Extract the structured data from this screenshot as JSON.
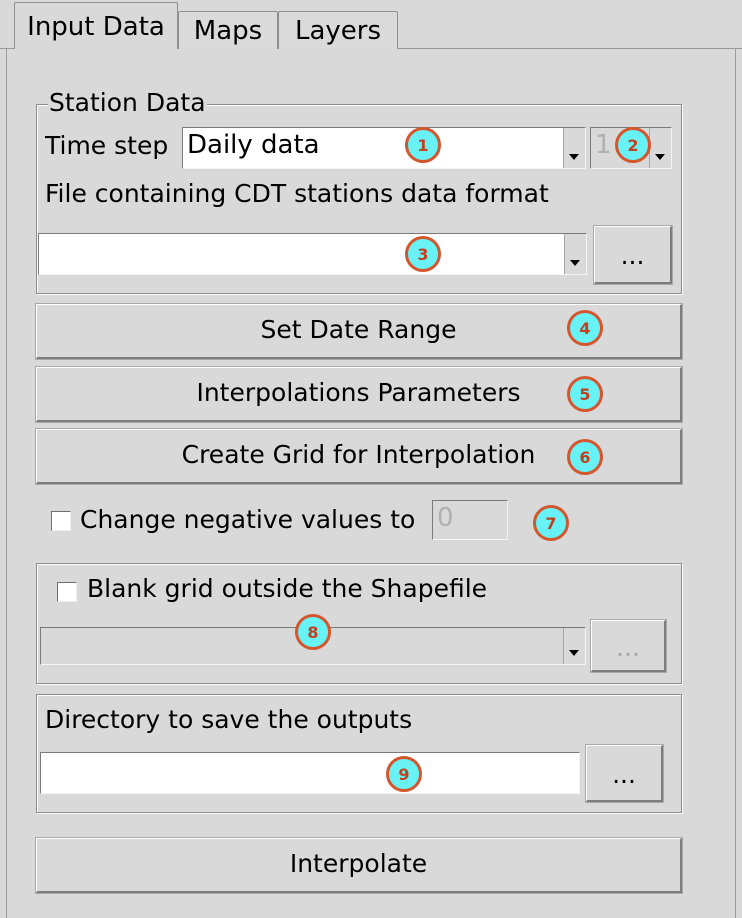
{
  "tabs": [
    {
      "label": "Input Data",
      "active": true
    },
    {
      "label": "Maps",
      "active": false
    },
    {
      "label": "Layers",
      "active": false
    }
  ],
  "station_data": {
    "legend": "Station Data",
    "time_step_label": "Time step",
    "time_step_value": "Daily data",
    "time_step_num": "1",
    "file_label": "File containing CDT stations data format",
    "file_value": "",
    "browse_label": "..."
  },
  "buttons": {
    "set_date_range": "Set Date Range",
    "interp_params": "Interpolations Parameters",
    "create_grid": "Create Grid for Interpolation",
    "interpolate": "Interpolate"
  },
  "negative": {
    "label": "Change negative values to",
    "value": "0",
    "checked": false
  },
  "shapefile": {
    "label": "Blank grid outside the Shapefile",
    "checked": false,
    "value": "",
    "browse_label": "..."
  },
  "output_dir": {
    "label": "Directory to save the outputs",
    "value": "",
    "browse_label": "..."
  },
  "markers": [
    "1",
    "2",
    "3",
    "4",
    "5",
    "6",
    "7",
    "8",
    "9"
  ],
  "colors": {
    "background": "#d9d9d9",
    "marker_fill": "#68f2f6",
    "marker_border": "#d4562c"
  }
}
